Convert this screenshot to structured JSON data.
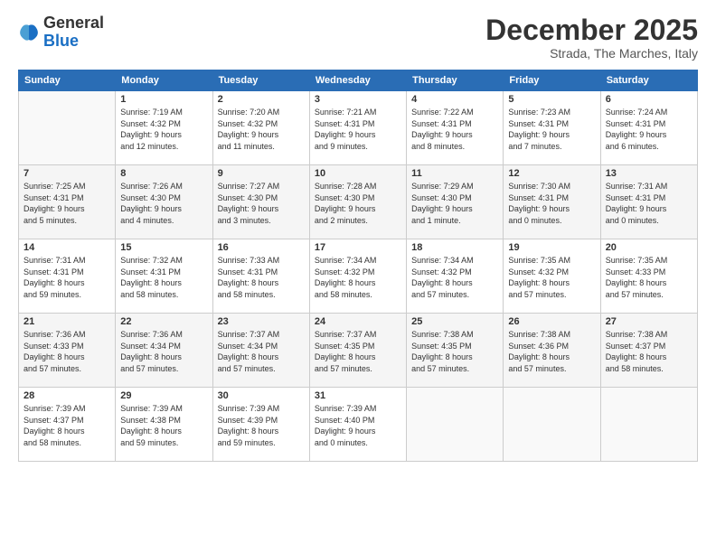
{
  "logo": {
    "general": "General",
    "blue": "Blue"
  },
  "header": {
    "month": "December 2025",
    "location": "Strada, The Marches, Italy"
  },
  "weekdays": [
    "Sunday",
    "Monday",
    "Tuesday",
    "Wednesday",
    "Thursday",
    "Friday",
    "Saturday"
  ],
  "weeks": [
    [
      {
        "day": "",
        "info": ""
      },
      {
        "day": "1",
        "info": "Sunrise: 7:19 AM\nSunset: 4:32 PM\nDaylight: 9 hours\nand 12 minutes."
      },
      {
        "day": "2",
        "info": "Sunrise: 7:20 AM\nSunset: 4:32 PM\nDaylight: 9 hours\nand 11 minutes."
      },
      {
        "day": "3",
        "info": "Sunrise: 7:21 AM\nSunset: 4:31 PM\nDaylight: 9 hours\nand 9 minutes."
      },
      {
        "day": "4",
        "info": "Sunrise: 7:22 AM\nSunset: 4:31 PM\nDaylight: 9 hours\nand 8 minutes."
      },
      {
        "day": "5",
        "info": "Sunrise: 7:23 AM\nSunset: 4:31 PM\nDaylight: 9 hours\nand 7 minutes."
      },
      {
        "day": "6",
        "info": "Sunrise: 7:24 AM\nSunset: 4:31 PM\nDaylight: 9 hours\nand 6 minutes."
      }
    ],
    [
      {
        "day": "7",
        "info": "Sunrise: 7:25 AM\nSunset: 4:31 PM\nDaylight: 9 hours\nand 5 minutes."
      },
      {
        "day": "8",
        "info": "Sunrise: 7:26 AM\nSunset: 4:30 PM\nDaylight: 9 hours\nand 4 minutes."
      },
      {
        "day": "9",
        "info": "Sunrise: 7:27 AM\nSunset: 4:30 PM\nDaylight: 9 hours\nand 3 minutes."
      },
      {
        "day": "10",
        "info": "Sunrise: 7:28 AM\nSunset: 4:30 PM\nDaylight: 9 hours\nand 2 minutes."
      },
      {
        "day": "11",
        "info": "Sunrise: 7:29 AM\nSunset: 4:30 PM\nDaylight: 9 hours\nand 1 minute."
      },
      {
        "day": "12",
        "info": "Sunrise: 7:30 AM\nSunset: 4:31 PM\nDaylight: 9 hours\nand 0 minutes."
      },
      {
        "day": "13",
        "info": "Sunrise: 7:31 AM\nSunset: 4:31 PM\nDaylight: 9 hours\nand 0 minutes."
      }
    ],
    [
      {
        "day": "14",
        "info": "Sunrise: 7:31 AM\nSunset: 4:31 PM\nDaylight: 8 hours\nand 59 minutes."
      },
      {
        "day": "15",
        "info": "Sunrise: 7:32 AM\nSunset: 4:31 PM\nDaylight: 8 hours\nand 58 minutes."
      },
      {
        "day": "16",
        "info": "Sunrise: 7:33 AM\nSunset: 4:31 PM\nDaylight: 8 hours\nand 58 minutes."
      },
      {
        "day": "17",
        "info": "Sunrise: 7:34 AM\nSunset: 4:32 PM\nDaylight: 8 hours\nand 58 minutes."
      },
      {
        "day": "18",
        "info": "Sunrise: 7:34 AM\nSunset: 4:32 PM\nDaylight: 8 hours\nand 57 minutes."
      },
      {
        "day": "19",
        "info": "Sunrise: 7:35 AM\nSunset: 4:32 PM\nDaylight: 8 hours\nand 57 minutes."
      },
      {
        "day": "20",
        "info": "Sunrise: 7:35 AM\nSunset: 4:33 PM\nDaylight: 8 hours\nand 57 minutes."
      }
    ],
    [
      {
        "day": "21",
        "info": "Sunrise: 7:36 AM\nSunset: 4:33 PM\nDaylight: 8 hours\nand 57 minutes."
      },
      {
        "day": "22",
        "info": "Sunrise: 7:36 AM\nSunset: 4:34 PM\nDaylight: 8 hours\nand 57 minutes."
      },
      {
        "day": "23",
        "info": "Sunrise: 7:37 AM\nSunset: 4:34 PM\nDaylight: 8 hours\nand 57 minutes."
      },
      {
        "day": "24",
        "info": "Sunrise: 7:37 AM\nSunset: 4:35 PM\nDaylight: 8 hours\nand 57 minutes."
      },
      {
        "day": "25",
        "info": "Sunrise: 7:38 AM\nSunset: 4:35 PM\nDaylight: 8 hours\nand 57 minutes."
      },
      {
        "day": "26",
        "info": "Sunrise: 7:38 AM\nSunset: 4:36 PM\nDaylight: 8 hours\nand 57 minutes."
      },
      {
        "day": "27",
        "info": "Sunrise: 7:38 AM\nSunset: 4:37 PM\nDaylight: 8 hours\nand 58 minutes."
      }
    ],
    [
      {
        "day": "28",
        "info": "Sunrise: 7:39 AM\nSunset: 4:37 PM\nDaylight: 8 hours\nand 58 minutes."
      },
      {
        "day": "29",
        "info": "Sunrise: 7:39 AM\nSunset: 4:38 PM\nDaylight: 8 hours\nand 59 minutes."
      },
      {
        "day": "30",
        "info": "Sunrise: 7:39 AM\nSunset: 4:39 PM\nDaylight: 8 hours\nand 59 minutes."
      },
      {
        "day": "31",
        "info": "Sunrise: 7:39 AM\nSunset: 4:40 PM\nDaylight: 9 hours\nand 0 minutes."
      },
      {
        "day": "",
        "info": ""
      },
      {
        "day": "",
        "info": ""
      },
      {
        "day": "",
        "info": ""
      }
    ]
  ]
}
